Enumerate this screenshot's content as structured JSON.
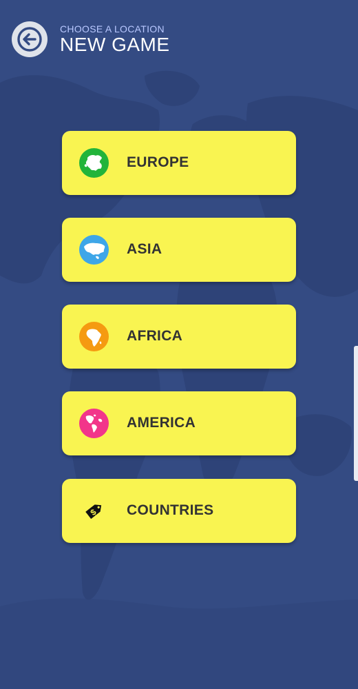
{
  "header": {
    "subtitle": "CHOOSE A LOCATION",
    "title": "NEW GAME"
  },
  "back_icon": "arrow-left-icon",
  "menu": [
    {
      "label": "EUROPE",
      "icon": "europe-map-icon",
      "color": "#22b43a"
    },
    {
      "label": "ASIA",
      "icon": "asia-map-icon",
      "color": "#3ea6e8"
    },
    {
      "label": "AFRICA",
      "icon": "africa-map-icon",
      "color": "#f59a11"
    },
    {
      "label": "AMERICA",
      "icon": "america-map-icon",
      "color": "#f2358a"
    },
    {
      "label": "COUNTRIES",
      "icon": "price-tag-icon",
      "color": "#f9f451"
    }
  ],
  "colors": {
    "background": "#344b83",
    "button": "#f9f451",
    "button_text": "#333333",
    "subtitle": "#b9c8ff"
  }
}
